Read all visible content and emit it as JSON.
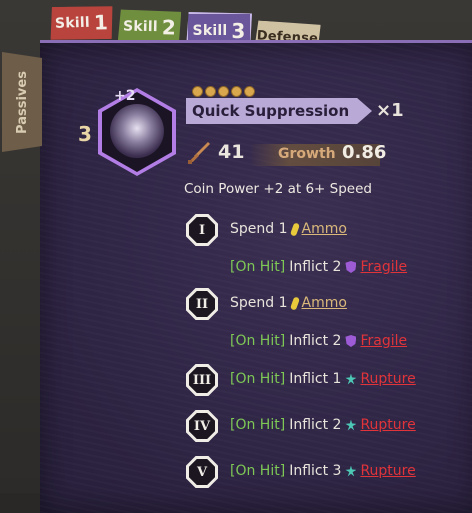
{
  "tabs": [
    {
      "label": "Skill",
      "num": "1",
      "color": "#b8443d"
    },
    {
      "label": "Skill",
      "num": "2",
      "color": "#6f8f3f"
    },
    {
      "label": "Skill",
      "num": "3",
      "color": "#6a569a",
      "active": true
    },
    {
      "label": "Defense",
      "color": "#cfc2a3"
    }
  ],
  "side_tab": "Passives",
  "skill": {
    "level": "3",
    "offset": "+2",
    "name": "Quick Suppression",
    "multiplier": "×1",
    "coins": 5,
    "power": "41",
    "growth_label": "Growth",
    "growth_value": "0.86",
    "coin_power_note": "Coin Power +2 at 6+ Speed"
  },
  "rows": [
    {
      "numeral": "I",
      "parts": {
        "text": "Spend 1",
        "kw": "Ammo"
      }
    },
    {
      "numeral": null,
      "parts": {
        "onhit": "[On Hit]",
        "text": "Inflict 2",
        "kw": "Fragile"
      }
    },
    {
      "numeral": "II",
      "parts": {
        "text": "Spend 1",
        "kw": "Ammo"
      }
    },
    {
      "numeral": null,
      "parts": {
        "onhit": "[On Hit]",
        "text": "Inflict 2",
        "kw": "Fragile"
      }
    },
    {
      "numeral": "III",
      "parts": {
        "onhit": "[On Hit]",
        "text": "Inflict 1",
        "kw": "Rupture"
      }
    },
    {
      "numeral": "IV",
      "parts": {
        "onhit": "[On Hit]",
        "text": "Inflict 2",
        "kw": "Rupture"
      }
    },
    {
      "numeral": "V",
      "parts": {
        "onhit": "[On Hit]",
        "text": "Inflict 3",
        "kw": "Rupture"
      }
    }
  ],
  "colors": {
    "card_bg": "#2f2545",
    "on_hit": "#7ec856",
    "keyword_red": "#e0343a",
    "keyword_ammo": "#d9b87a",
    "fragile_icon": "#9d5bd6",
    "rupture_icon": "#4cc8b5",
    "ammo_icon": "#e7c93b"
  },
  "icons": {
    "ammo": "ammo-icon",
    "fragile": "fragile-icon",
    "rupture": "rupture-icon",
    "attack": "sword-icon"
  }
}
